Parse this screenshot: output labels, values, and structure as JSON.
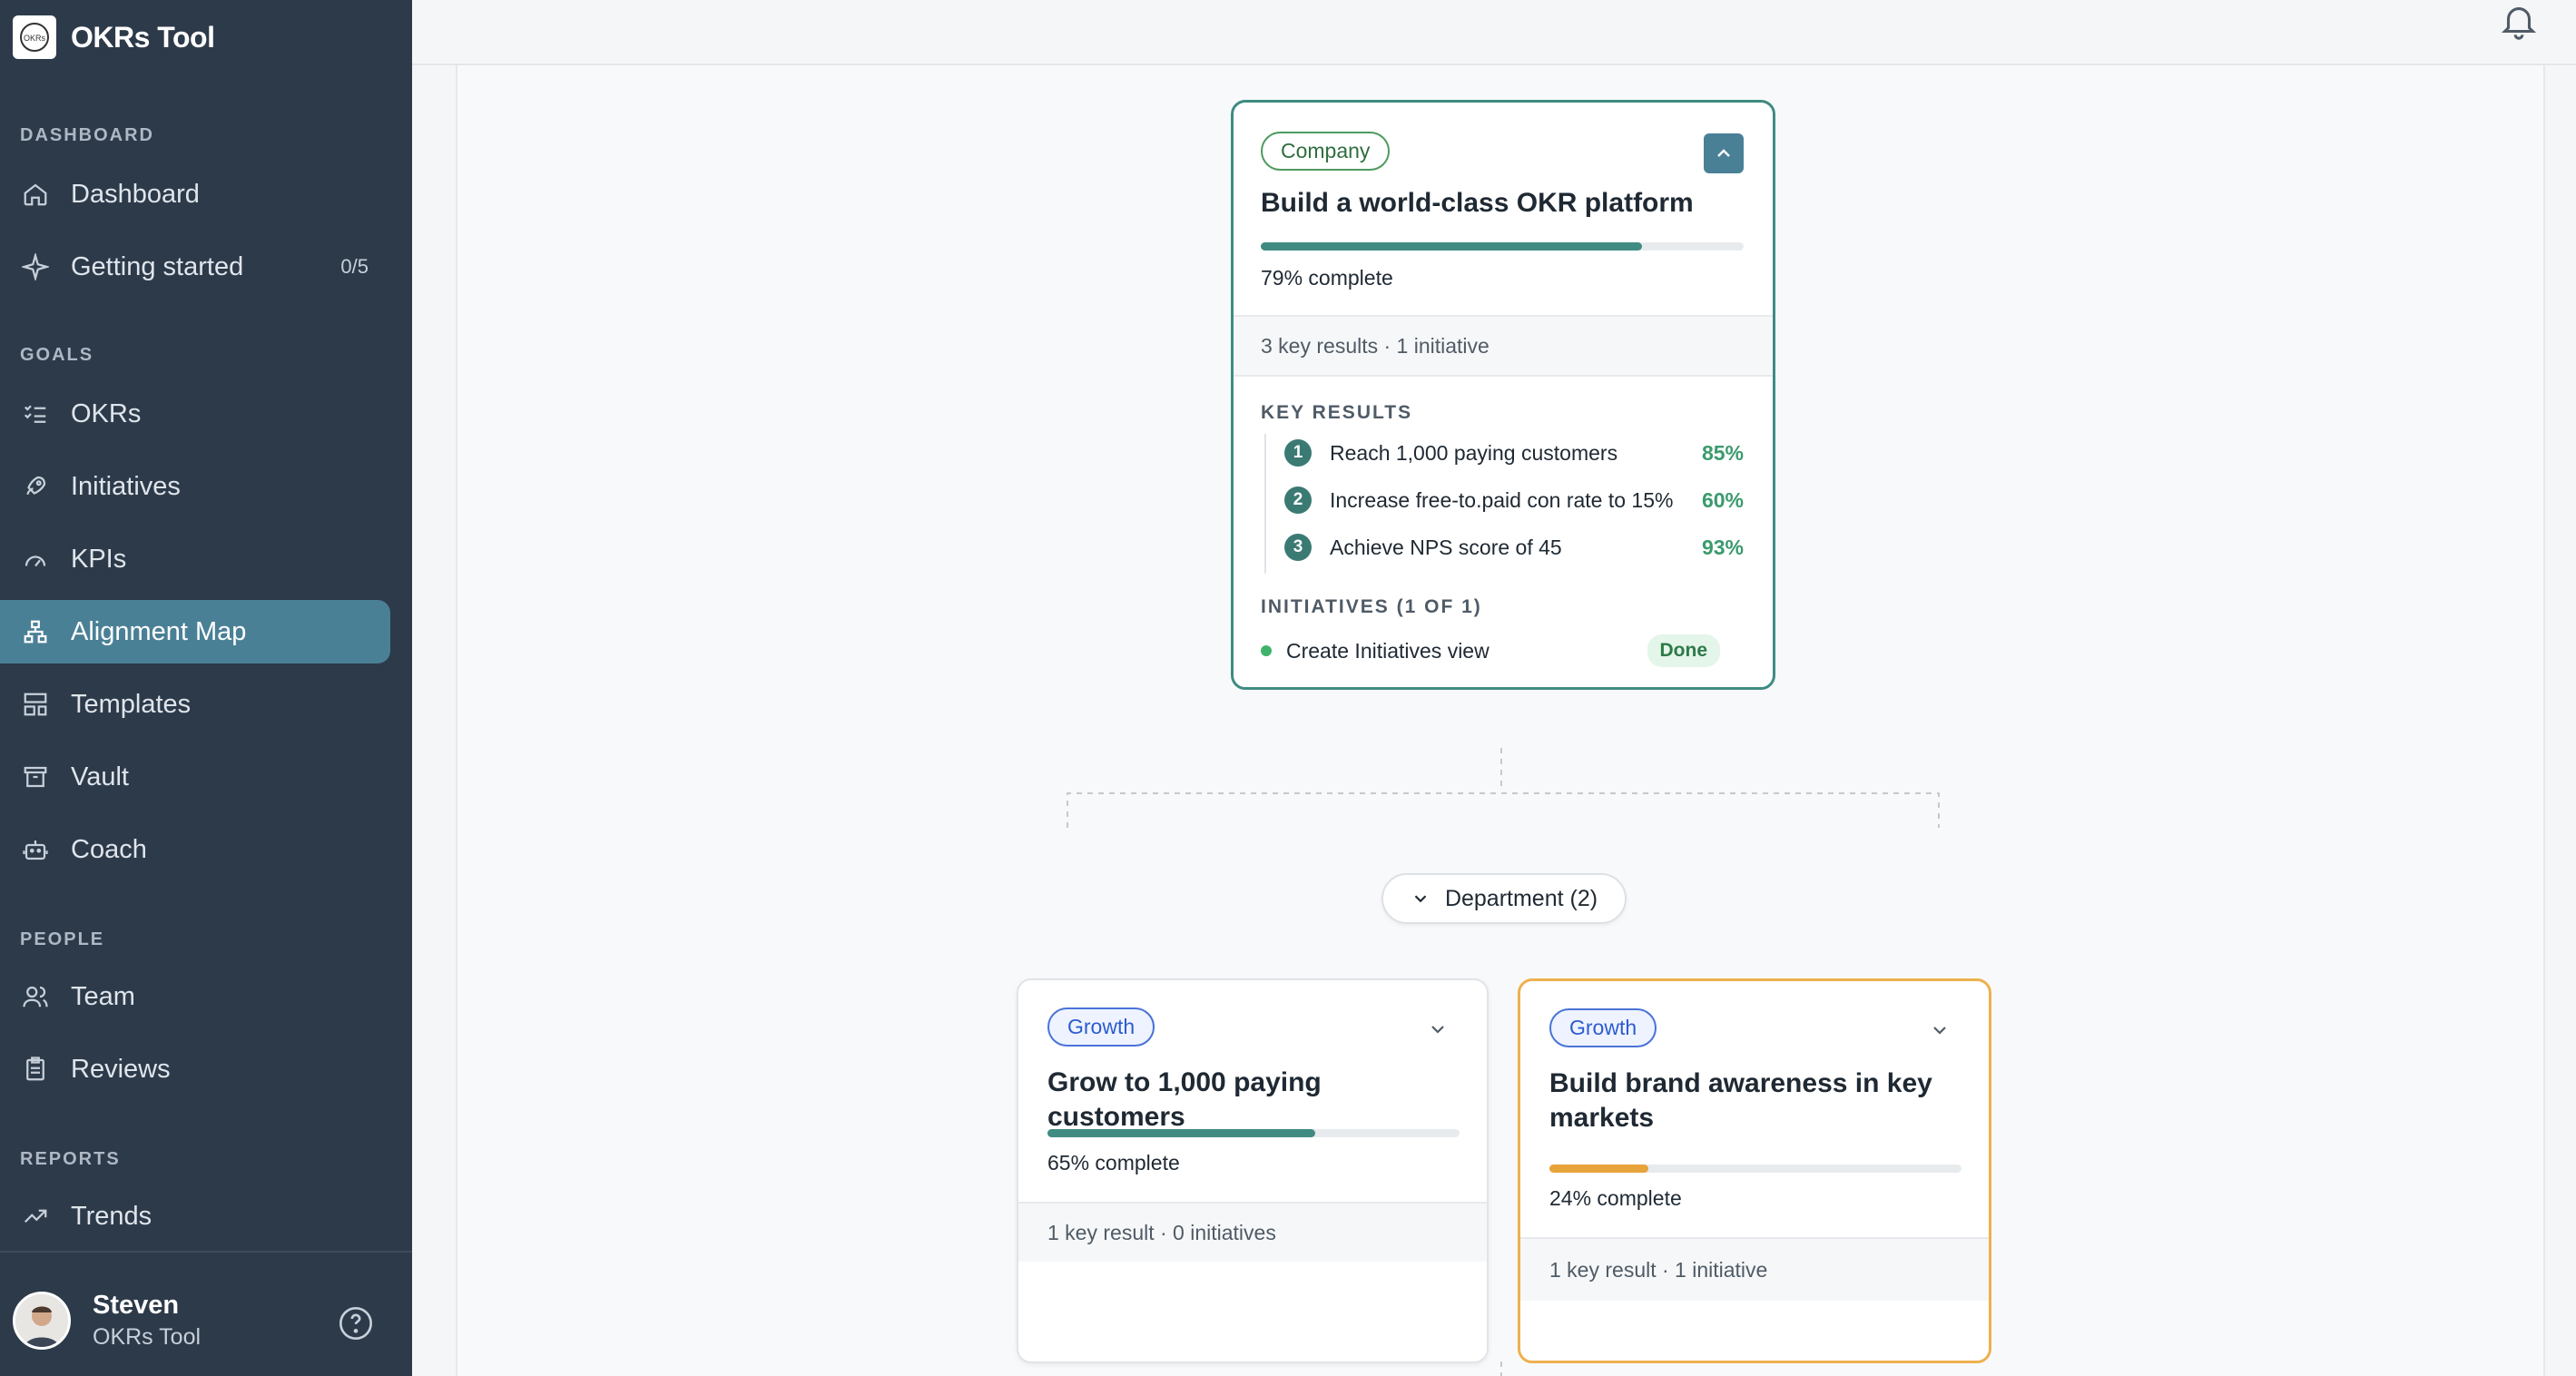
{
  "app": {
    "name": "OKRs Tool",
    "logo_text": "OKRs"
  },
  "sidebar": {
    "sections": {
      "dashboard": "DASHBOARD",
      "goals": "GOALS",
      "people": "PEOPLE",
      "reports": "REPORTS"
    },
    "items": [
      {
        "label": "Dashboard",
        "icon": "home-icon"
      },
      {
        "label": "Getting started",
        "icon": "sparkle-icon",
        "count": "0/5"
      },
      {
        "label": "OKRs",
        "icon": "checklist-icon"
      },
      {
        "label": "Initiatives",
        "icon": "rocket-icon"
      },
      {
        "label": "KPIs",
        "icon": "gauge-icon"
      },
      {
        "label": "Alignment Map",
        "icon": "hierarchy-icon",
        "active": true
      },
      {
        "label": "Templates",
        "icon": "layout-icon"
      },
      {
        "label": "Vault",
        "icon": "archive-icon"
      },
      {
        "label": "Coach",
        "icon": "robot-icon"
      },
      {
        "label": "Team",
        "icon": "users-icon"
      },
      {
        "label": "Reviews",
        "icon": "clipboard-icon"
      },
      {
        "label": "Trends",
        "icon": "trend-icon"
      }
    ],
    "user": {
      "name": "Steven",
      "org": "OKRs Tool"
    }
  },
  "company_card": {
    "tag": "Company",
    "title": "Build a world-class OKR platform",
    "progress": 0.79,
    "pct_label": "79% complete",
    "summary": "3 key results · 1 initiative",
    "key_results_heading": "KEY RESULTS",
    "key_results": [
      {
        "num": "1",
        "label": "Reach 1,000 paying customers",
        "pct": "85%"
      },
      {
        "num": "2",
        "label": "Increase free-to.paid con rate to 15%",
        "pct": "60%"
      },
      {
        "num": "3",
        "label": "Achieve NPS score of 45",
        "pct": "93%"
      }
    ],
    "initiatives_heading": "INITIATIVES (1 OF 1)",
    "initiatives": [
      {
        "label": "Create Initiatives view",
        "status": "Done"
      }
    ]
  },
  "department_toggle": {
    "label": "Department (2)"
  },
  "dept_cards": [
    {
      "tag": "Growth",
      "title": "Grow to 1,000 paying customers",
      "progress": 0.65,
      "pct_label": "65% complete",
      "summary": "1 key result · 0 initiatives"
    },
    {
      "tag": "Growth",
      "title": "Build brand awareness in key markets",
      "progress": 0.24,
      "pct_label": "24% complete",
      "summary": "1 key result · 1 initiative"
    }
  ],
  "colors": {
    "sidebar_bg": "#2d3a4a",
    "active_item": "#4a8096",
    "progress_green": "#3f8b82",
    "progress_orange": "#e8a33a",
    "card_border_green": "#3f8b82",
    "card_border_orange": "#eeb04f"
  }
}
